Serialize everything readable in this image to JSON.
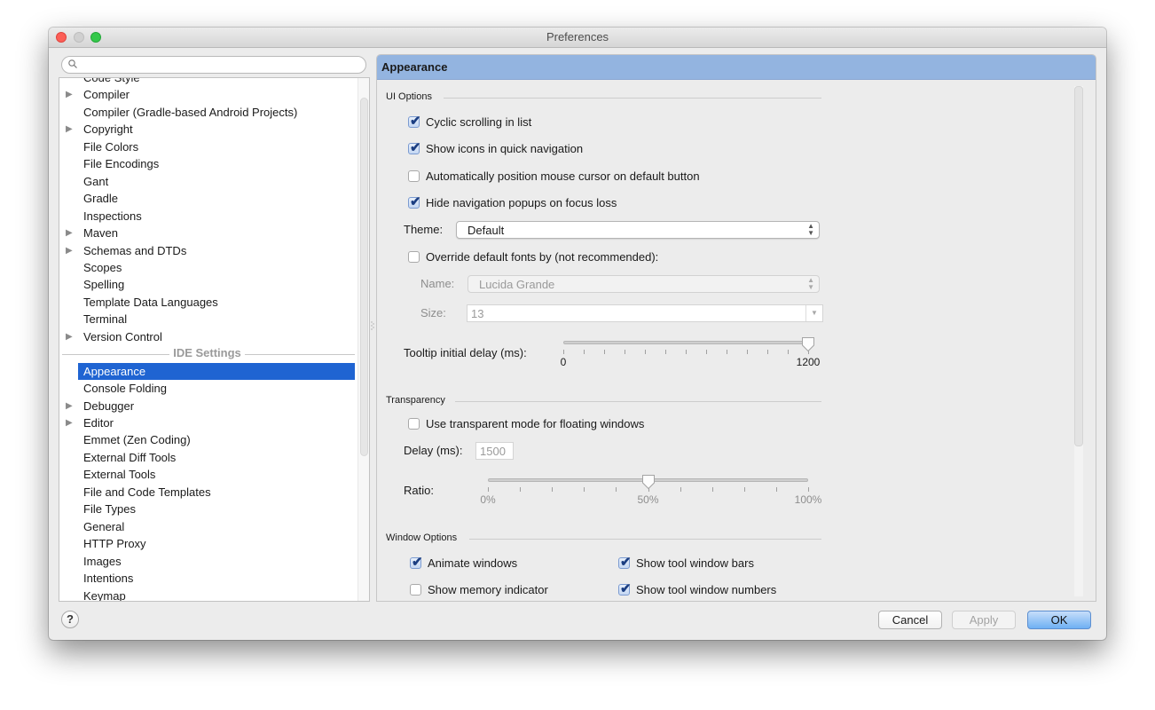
{
  "window": {
    "title": "Preferences"
  },
  "search": {
    "placeholder": "",
    "value": ""
  },
  "sidebar": {
    "partial_top_item": "Code Style",
    "project_items": [
      {
        "label": "Compiler",
        "expandable": true
      },
      {
        "label": "Compiler (Gradle-based Android Projects)",
        "expandable": false
      },
      {
        "label": "Copyright",
        "expandable": true
      },
      {
        "label": "File Colors",
        "expandable": false
      },
      {
        "label": "File Encodings",
        "expandable": false
      },
      {
        "label": "Gant",
        "expandable": false
      },
      {
        "label": "Gradle",
        "expandable": false
      },
      {
        "label": "Inspections",
        "expandable": false
      },
      {
        "label": "Maven",
        "expandable": true
      },
      {
        "label": "Schemas and DTDs",
        "expandable": true
      },
      {
        "label": "Scopes",
        "expandable": false
      },
      {
        "label": "Spelling",
        "expandable": false
      },
      {
        "label": "Template Data Languages",
        "expandable": false
      },
      {
        "label": "Terminal",
        "expandable": false
      },
      {
        "label": "Version Control",
        "expandable": true
      }
    ],
    "section_header": "IDE Settings",
    "ide_items": [
      {
        "label": "Appearance",
        "expandable": false,
        "selected": true
      },
      {
        "label": "Console Folding",
        "expandable": false
      },
      {
        "label": "Debugger",
        "expandable": true
      },
      {
        "label": "Editor",
        "expandable": true
      },
      {
        "label": "Emmet (Zen Coding)",
        "expandable": false
      },
      {
        "label": "External Diff Tools",
        "expandable": false
      },
      {
        "label": "External Tools",
        "expandable": false
      },
      {
        "label": "File and Code Templates",
        "expandable": false
      },
      {
        "label": "File Types",
        "expandable": false
      },
      {
        "label": "General",
        "expandable": false
      },
      {
        "label": "HTTP Proxy",
        "expandable": false
      },
      {
        "label": "Images",
        "expandable": false
      },
      {
        "label": "Intentions",
        "expandable": false
      },
      {
        "label": "Keymap",
        "expandable": false
      }
    ],
    "expand_glyph": "▶"
  },
  "panel": {
    "title": "Appearance",
    "ui_options": {
      "title": "UI Options",
      "checkboxes": [
        {
          "label": "Cyclic scrolling in list",
          "checked": true
        },
        {
          "label": "Show icons in quick navigation",
          "checked": true
        },
        {
          "label": "Automatically position mouse cursor on default button",
          "checked": false
        },
        {
          "label": "Hide navigation popups on focus loss",
          "checked": true
        }
      ],
      "theme_label": "Theme:",
      "theme_value": "Default",
      "override_fonts": {
        "label": "Override default fonts by (not recommended):",
        "checked": false
      },
      "name_label": "Name:",
      "name_value": "Lucida Grande",
      "size_label": "Size:",
      "size_value": "13",
      "tooltip_label": "Tooltip initial delay (ms):",
      "tooltip_slider": {
        "min": 0,
        "max": 1200,
        "value": 1200,
        "min_label": "0",
        "max_label": "1200",
        "ticks": 13
      }
    },
    "transparency": {
      "title": "Transparency",
      "use_transparent": {
        "label": "Use transparent mode for floating windows",
        "checked": false
      },
      "delay_label": "Delay (ms):",
      "delay_value": "1500",
      "ratio_label": "Ratio:",
      "ratio_slider": {
        "min": 0,
        "max": 100,
        "value": 50,
        "labels": [
          "0%",
          "50%",
          "100%"
        ],
        "ticks": 11
      }
    },
    "window_options": {
      "title": "Window Options",
      "checkboxes": [
        {
          "label": "Animate windows",
          "checked": true
        },
        {
          "label": "Show tool window bars",
          "checked": true
        },
        {
          "label": "Show memory indicator",
          "checked": false
        },
        {
          "label": "Show tool window numbers",
          "checked": true
        }
      ]
    }
  },
  "buttons": {
    "help": "?",
    "cancel": "Cancel",
    "apply": "Apply",
    "ok": "OK"
  },
  "glyphs": {
    "check": "✔",
    "combo_arrows": "▲▼",
    "dropdown": "▼"
  }
}
